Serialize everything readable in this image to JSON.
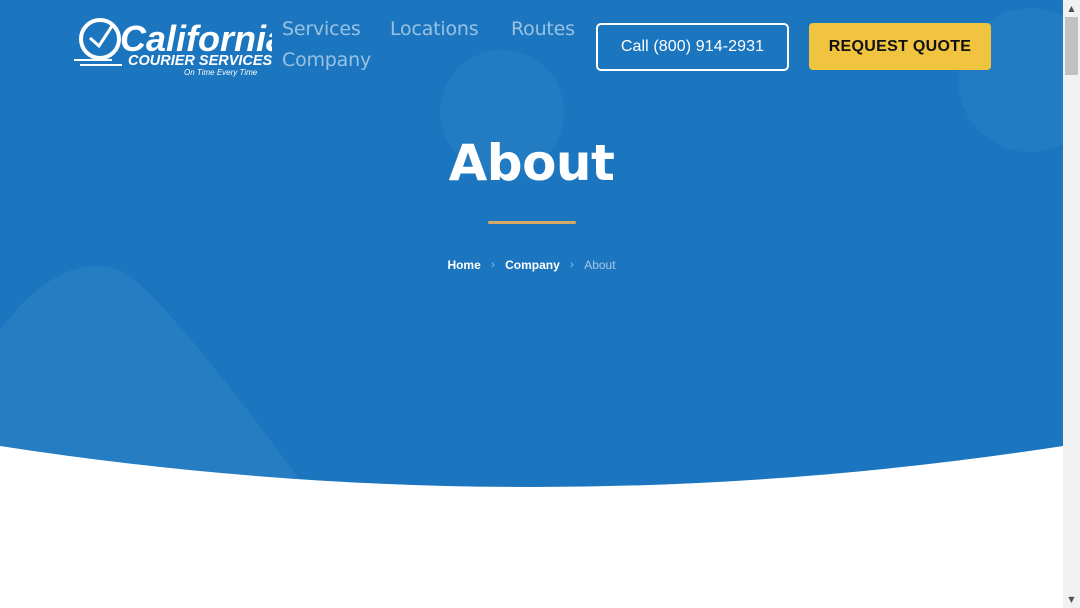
{
  "logo": {
    "wordmark": "California",
    "line2": "COURIER SERVICES",
    "tagline": "On Time Every Time"
  },
  "nav": {
    "items": [
      {
        "label": "Services"
      },
      {
        "label": "Locations"
      },
      {
        "label": "Routes"
      },
      {
        "label": "Company"
      }
    ]
  },
  "header": {
    "call_label": "Call (800) 914-2931",
    "quote_label": "REQUEST QUOTE"
  },
  "hero": {
    "title": "About",
    "breadcrumb": [
      "Home",
      "Company",
      "About"
    ]
  },
  "colors": {
    "hero_blue": "#1b76bf",
    "accent_yellow": "#f0c43f",
    "divider_gold": "#d7a965"
  }
}
